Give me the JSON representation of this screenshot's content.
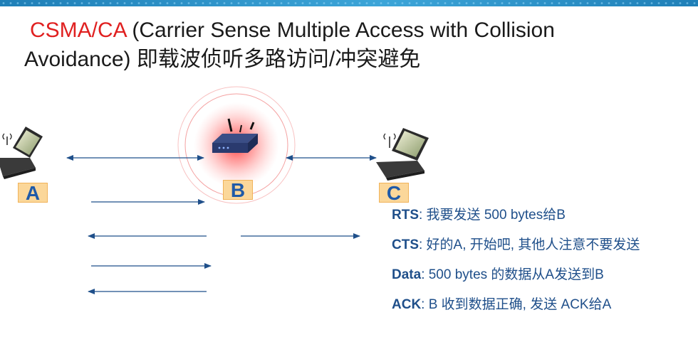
{
  "title": {
    "acronym": "CSMA/CA",
    "line1_rest": " (Carrier Sense Multiple Access with Collision",
    "line2": "Avoidance) 即载波侦听多路访问/冲突避免"
  },
  "nodes": {
    "a_label": "A",
    "b_label": "B",
    "c_label": "C"
  },
  "legend": [
    {
      "key": "RTS",
      "text": ": 我要发送 500 bytes给B"
    },
    {
      "key": "CTS",
      "text": ": 好的A, 开始吧, 其他人注意不要发送"
    },
    {
      "key": "Data",
      "text": ": 500 bytes 的数据从A发送到B"
    },
    {
      "key": "ACK",
      "text": ": B 收到数据正确, 发送 ACK给A"
    }
  ],
  "colors": {
    "arrow": "#1f4f8a",
    "accent": "#e02020",
    "label_fill": "#fbd79a",
    "label_text": "#1f5aa8"
  }
}
